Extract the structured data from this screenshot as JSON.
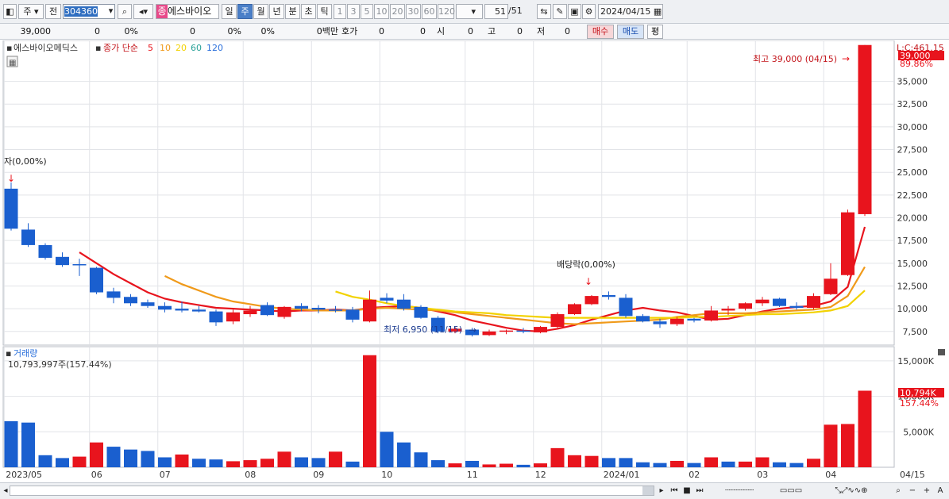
{
  "toolbar": {
    "market": "주",
    "prev_label": "전",
    "code": "304360",
    "stock_badge": "종",
    "stock_name": "에스바이오",
    "periods": [
      "일",
      "주",
      "월",
      "년",
      "분",
      "초",
      "틱"
    ],
    "active_period": "주",
    "intervals": [
      "1",
      "3",
      "5",
      "10",
      "20",
      "30",
      "60",
      "120"
    ],
    "count": "51",
    "count_total": "/51",
    "date": "2024/04/15"
  },
  "info": {
    "price": "39,000",
    "change": "0",
    "rate": "0%",
    "volume": "0",
    "vol_rate": "0%",
    "amount": "0백만",
    "quote_label": "호가",
    "quote_a": "0",
    "quote_b": "0",
    "open_label": "시",
    "open": "0",
    "high_label": "고",
    "high": "0",
    "low_label": "저",
    "low": "0",
    "buy_button": "매수",
    "sell_button": "매도",
    "eval_button": "평"
  },
  "price_panel": {
    "stock_label": "에스바이오메딕스",
    "ma_label": "종가 단순",
    "ma_periods": [
      "5",
      "10",
      "20",
      "60",
      "120"
    ],
    "ma_colors": [
      "#e8141d",
      "#f09a1a",
      "#f2d200",
      "#2aa198",
      "#2a6fdb"
    ],
    "right_top_label": "L:C:461.15",
    "last_price_badge": "39,000",
    "last_rate_badge": "89.86%",
    "high_annotation": "최고 39,000 (04/15)",
    "low_annotation": "최저 6,950 (11/15)",
    "right_annotation": "자(0,00%)",
    "dividend_annotation": "배당락(0,00%)"
  },
  "volume_panel": {
    "label": "거래량",
    "value_text": "10,793,997주(157.44%)",
    "last_volume_badge": "10,794K",
    "last_volume_rate": "157.44%"
  },
  "x_axis_labels": [
    "2023/05",
    "06",
    "07",
    "08",
    "09",
    "10",
    "11",
    "12",
    "2024/01",
    "02",
    "03",
    "04"
  ],
  "x_axis_right": "04/15",
  "colors": {
    "up": "#e8141d",
    "down": "#1a5fcf",
    "grid": "#e2e4e8"
  },
  "chart_data": [
    {
      "type": "candlestick",
      "title": "",
      "ylim": [
        6000,
        39500
      ],
      "y_ticks": [
        7500,
        10000,
        12500,
        15000,
        17500,
        20000,
        22500,
        25000,
        27500,
        30000,
        32500,
        35000
      ],
      "y_tick_labels": [
        "7,500",
        "10,000",
        "12,500",
        "15,000",
        "17,500",
        "20,000",
        "22,500",
        "25,000",
        "27,500",
        "30,000",
        "32,500",
        "35,000"
      ],
      "candles": [
        {
          "o": 23200,
          "h": 23900,
          "l": 18600,
          "c": 18800
        },
        {
          "o": 18700,
          "h": 19400,
          "l": 16800,
          "c": 17000
        },
        {
          "o": 17000,
          "h": 17200,
          "l": 15400,
          "c": 15600
        },
        {
          "o": 15700,
          "h": 16200,
          "l": 14600,
          "c": 14800
        },
        {
          "o": 14900,
          "h": 15500,
          "l": 13600,
          "c": 14800
        },
        {
          "o": 14500,
          "h": 14600,
          "l": 11600,
          "c": 11800
        },
        {
          "o": 11900,
          "h": 12300,
          "l": 10600,
          "c": 11200
        },
        {
          "o": 11300,
          "h": 11600,
          "l": 10300,
          "c": 10600
        },
        {
          "o": 10700,
          "h": 11000,
          "l": 10100,
          "c": 10300
        },
        {
          "o": 10300,
          "h": 10700,
          "l": 9600,
          "c": 9900
        },
        {
          "o": 10000,
          "h": 10800,
          "l": 9600,
          "c": 9800
        },
        {
          "o": 9900,
          "h": 10300,
          "l": 9600,
          "c": 9700
        },
        {
          "o": 9700,
          "h": 9900,
          "l": 8100,
          "c": 8500
        },
        {
          "o": 8600,
          "h": 9900,
          "l": 8300,
          "c": 9600
        },
        {
          "o": 9400,
          "h": 10300,
          "l": 9100,
          "c": 9800
        },
        {
          "o": 10400,
          "h": 10700,
          "l": 9200,
          "c": 9300
        },
        {
          "o": 9100,
          "h": 10300,
          "l": 8900,
          "c": 10200
        },
        {
          "o": 10300,
          "h": 10600,
          "l": 9700,
          "c": 10000
        },
        {
          "o": 10100,
          "h": 10400,
          "l": 9500,
          "c": 9900
        },
        {
          "o": 9900,
          "h": 10300,
          "l": 9600,
          "c": 9800
        },
        {
          "o": 9900,
          "h": 10200,
          "l": 8500,
          "c": 8800
        },
        {
          "o": 8600,
          "h": 12000,
          "l": 8500,
          "c": 11000
        },
        {
          "o": 11200,
          "h": 11700,
          "l": 10600,
          "c": 10900
        },
        {
          "o": 11000,
          "h": 11600,
          "l": 9800,
          "c": 10000
        },
        {
          "o": 10200,
          "h": 10400,
          "l": 8900,
          "c": 9000
        },
        {
          "o": 9000,
          "h": 9200,
          "l": 7300,
          "c": 7500
        },
        {
          "o": 7500,
          "h": 8000,
          "l": 7300,
          "c": 7800
        },
        {
          "o": 7700,
          "h": 7900,
          "l": 6950,
          "c": 7100
        },
        {
          "o": 7100,
          "h": 7700,
          "l": 7000,
          "c": 7500
        },
        {
          "o": 7500,
          "h": 7700,
          "l": 7200,
          "c": 7600
        },
        {
          "o": 7600,
          "h": 7900,
          "l": 7300,
          "c": 7500
        },
        {
          "o": 7400,
          "h": 8100,
          "l": 7300,
          "c": 8000
        },
        {
          "o": 8000,
          "h": 9600,
          "l": 7900,
          "c": 9400
        },
        {
          "o": 9400,
          "h": 10600,
          "l": 9300,
          "c": 10500
        },
        {
          "o": 10500,
          "h": 11500,
          "l": 10400,
          "c": 11400
        },
        {
          "o": 11500,
          "h": 11900,
          "l": 11000,
          "c": 11300
        },
        {
          "o": 11200,
          "h": 11600,
          "l": 9000,
          "c": 9200
        },
        {
          "o": 9200,
          "h": 9400,
          "l": 8500,
          "c": 8600
        },
        {
          "o": 8600,
          "h": 8900,
          "l": 7900,
          "c": 8300
        },
        {
          "o": 8300,
          "h": 9100,
          "l": 8100,
          "c": 8900
        },
        {
          "o": 8900,
          "h": 9000,
          "l": 8500,
          "c": 8700
        },
        {
          "o": 8700,
          "h": 10300,
          "l": 8600,
          "c": 9800
        },
        {
          "o": 9800,
          "h": 10300,
          "l": 9300,
          "c": 10000
        },
        {
          "o": 10000,
          "h": 10700,
          "l": 9800,
          "c": 10600
        },
        {
          "o": 10600,
          "h": 11300,
          "l": 10300,
          "c": 11000
        },
        {
          "o": 11100,
          "h": 11200,
          "l": 10200,
          "c": 10300
        },
        {
          "o": 10300,
          "h": 10700,
          "l": 9900,
          "c": 10100
        },
        {
          "o": 10100,
          "h": 11700,
          "l": 9900,
          "c": 11400
        },
        {
          "o": 11600,
          "h": 15000,
          "l": 11500,
          "c": 13300
        },
        {
          "o": 13700,
          "h": 20900,
          "l": 13600,
          "c": 20600
        },
        {
          "o": 20400,
          "h": 39000,
          "l": 20200,
          "c": 39000
        }
      ],
      "series": [
        {
          "name": "5",
          "values": [
            null,
            null,
            null,
            null,
            16200,
            15000,
            13800,
            12800,
            11800,
            11100,
            10700,
            10400,
            10100,
            10000,
            9900,
            9800,
            9700,
            9800,
            9800,
            9900,
            9800,
            10100,
            10200,
            10300,
            10100,
            9700,
            9300,
            8700,
            8300,
            7900,
            7600,
            7500,
            7800,
            8200,
            8800,
            9300,
            9800,
            10100,
            9800,
            9600,
            9200,
            8800,
            8900,
            9300,
            9700,
            10000,
            10200,
            10300,
            10800,
            12400,
            19000
          ]
        },
        {
          "name": "10",
          "values": [
            null,
            null,
            null,
            null,
            null,
            null,
            null,
            null,
            null,
            13600,
            12700,
            12000,
            11300,
            10800,
            10500,
            10200,
            10000,
            9900,
            9800,
            9800,
            9800,
            10000,
            10100,
            10000,
            9900,
            9800,
            9600,
            9400,
            9200,
            9000,
            8800,
            8600,
            8400,
            8300,
            8400,
            8500,
            8600,
            8700,
            8800,
            9100,
            9300,
            9500,
            9500,
            9500,
            9600,
            9700,
            9800,
            9900,
            10200,
            11400,
            14600
          ]
        },
        {
          "name": "20",
          "values": [
            null,
            null,
            null,
            null,
            null,
            null,
            null,
            null,
            null,
            null,
            null,
            null,
            null,
            null,
            null,
            null,
            null,
            null,
            null,
            11900,
            11300,
            11000,
            10600,
            10300,
            10100,
            9900,
            9700,
            9600,
            9500,
            9300,
            9200,
            9100,
            9000,
            9000,
            9000,
            9000,
            9000,
            9000,
            9000,
            9000,
            9100,
            9100,
            9200,
            9300,
            9400,
            9400,
            9500,
            9600,
            9800,
            10300,
            12000
          ]
        }
      ]
    },
    {
      "type": "bar",
      "title": "거래량",
      "ylim": [
        0,
        17000
      ],
      "y_ticks": [
        5000,
        10000,
        15000
      ],
      "y_tick_labels": [
        "5,000K",
        "10,000K",
        "15,000K"
      ],
      "values": [
        6500,
        6300,
        1700,
        1300,
        1500,
        3500,
        2900,
        2500,
        2300,
        1400,
        1800,
        1200,
        1100,
        850,
        1000,
        1200,
        2200,
        1400,
        1300,
        2200,
        800,
        15800,
        5000,
        3500,
        2100,
        1000,
        550,
        900,
        400,
        500,
        350,
        550,
        2700,
        1700,
        1600,
        1300,
        1300,
        700,
        600,
        900,
        600,
        1400,
        800,
        800,
        1400,
        700,
        600,
        1200,
        6000,
        6100,
        10794
      ],
      "up": [
        false,
        false,
        false,
        false,
        true,
        true,
        false,
        false,
        false,
        false,
        true,
        false,
        false,
        true,
        true,
        true,
        true,
        false,
        false,
        true,
        false,
        true,
        false,
        false,
        false,
        false,
        true,
        false,
        true,
        true,
        false,
        true,
        true,
        true,
        true,
        false,
        false,
        false,
        false,
        true,
        false,
        true,
        false,
        true,
        true,
        false,
        false,
        true,
        true,
        true,
        true
      ]
    }
  ]
}
